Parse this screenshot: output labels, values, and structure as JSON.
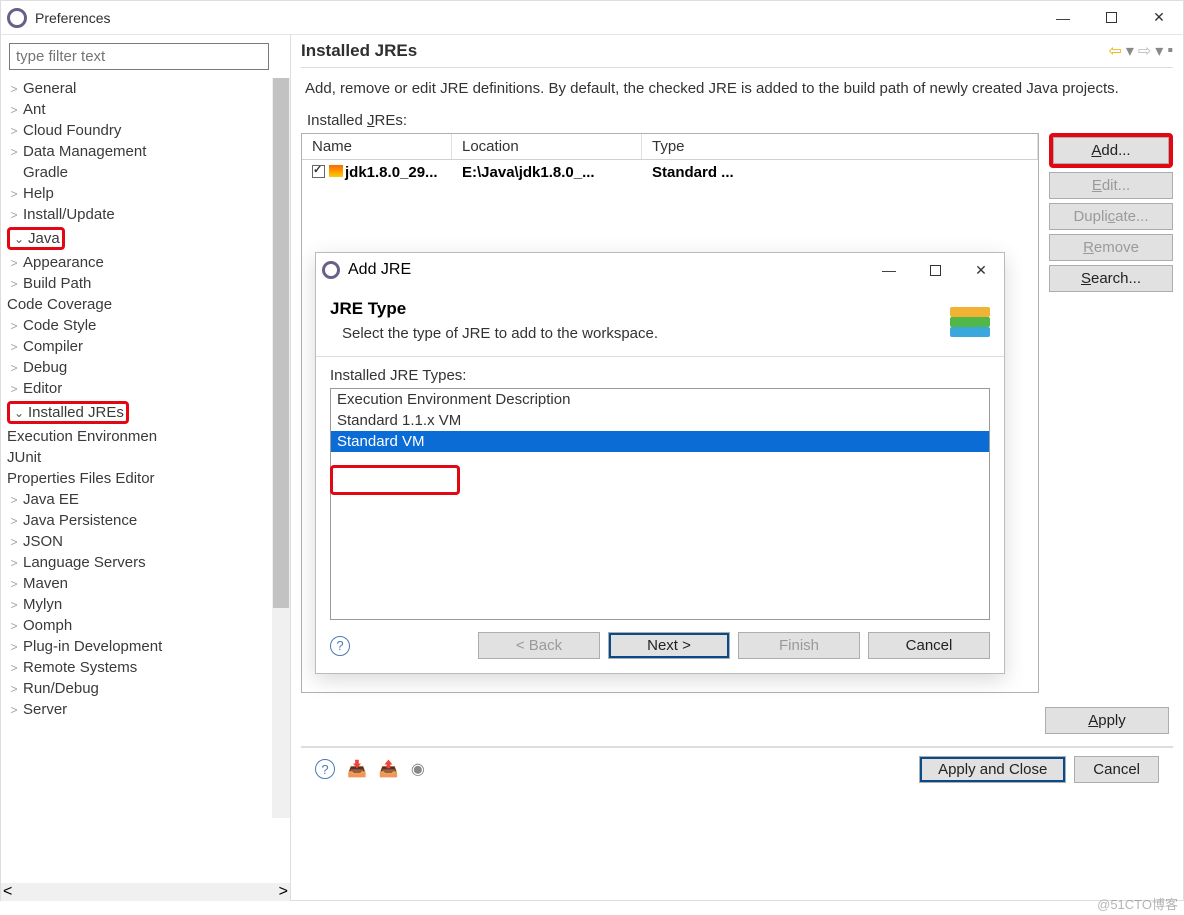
{
  "window": {
    "title": "Preferences",
    "controls": {
      "min": "—",
      "max": "☐",
      "close": "✕"
    }
  },
  "filter": {
    "placeholder": "type filter text"
  },
  "tree": {
    "items": [
      {
        "label": "General",
        "chev": ">"
      },
      {
        "label": "Ant",
        "chev": ">"
      },
      {
        "label": "Cloud Foundry",
        "chev": ">"
      },
      {
        "label": "Data Management",
        "chev": ">"
      },
      {
        "label": "Gradle",
        "chev": ""
      },
      {
        "label": "Help",
        "chev": ">"
      },
      {
        "label": "Install/Update",
        "chev": ">"
      }
    ],
    "java": {
      "label": "Java",
      "children": [
        {
          "label": "Appearance",
          "chev": ">"
        },
        {
          "label": "Build Path",
          "chev": ">"
        },
        {
          "label": "Code Coverage",
          "chev": ""
        },
        {
          "label": "Code Style",
          "chev": ">"
        },
        {
          "label": "Compiler",
          "chev": ">"
        },
        {
          "label": "Debug",
          "chev": ">"
        },
        {
          "label": "Editor",
          "chev": ">"
        }
      ],
      "installed_jres": {
        "label": "Installed JREs",
        "child": "Execution Environmen"
      },
      "after": [
        {
          "label": "JUnit",
          "chev": ""
        },
        {
          "label": "Properties Files Editor",
          "chev": ""
        }
      ]
    },
    "rest": [
      {
        "label": "Java EE",
        "chev": ">"
      },
      {
        "label": "Java Persistence",
        "chev": ">"
      },
      {
        "label": "JSON",
        "chev": ">"
      },
      {
        "label": "Language Servers",
        "chev": ">"
      },
      {
        "label": "Maven",
        "chev": ">"
      },
      {
        "label": "Mylyn",
        "chev": ">"
      },
      {
        "label": "Oomph",
        "chev": ">"
      },
      {
        "label": "Plug-in Development",
        "chev": ">"
      },
      {
        "label": "Remote Systems",
        "chev": ">"
      },
      {
        "label": "Run/Debug",
        "chev": ">"
      },
      {
        "label": "Server",
        "chev": ">"
      }
    ]
  },
  "page": {
    "title": "Installed JREs",
    "description": "Add, remove or edit JRE definitions. By default, the checked JRE is added to the build path of newly created Java projects.",
    "list_label": "Installed JREs:",
    "columns": {
      "c1": "Name",
      "c2": "Location",
      "c3": "Type"
    },
    "row": {
      "name": "jdk1.8.0_29...",
      "loc": "E:\\Java\\jdk1.8.0_...",
      "type": "Standard ..."
    },
    "buttons": {
      "add": "Add...",
      "edit": "Edit...",
      "duplicate": "Duplicate...",
      "remove": "Remove",
      "search": "Search..."
    },
    "apply": "Apply"
  },
  "bottom": {
    "apply_close": "Apply and Close",
    "cancel": "Cancel"
  },
  "dialog": {
    "title": "Add JRE",
    "heading": "JRE Type",
    "subtitle": "Select the type of JRE to add to the workspace.",
    "list_label": "Installed JRE Types:",
    "options": [
      "Execution Environment Description",
      "Standard 1.1.x VM",
      "Standard VM"
    ],
    "buttons": {
      "back": "< Back",
      "next": "Next >",
      "finish": "Finish",
      "cancel": "Cancel"
    }
  },
  "watermark": "@51CTO博客"
}
